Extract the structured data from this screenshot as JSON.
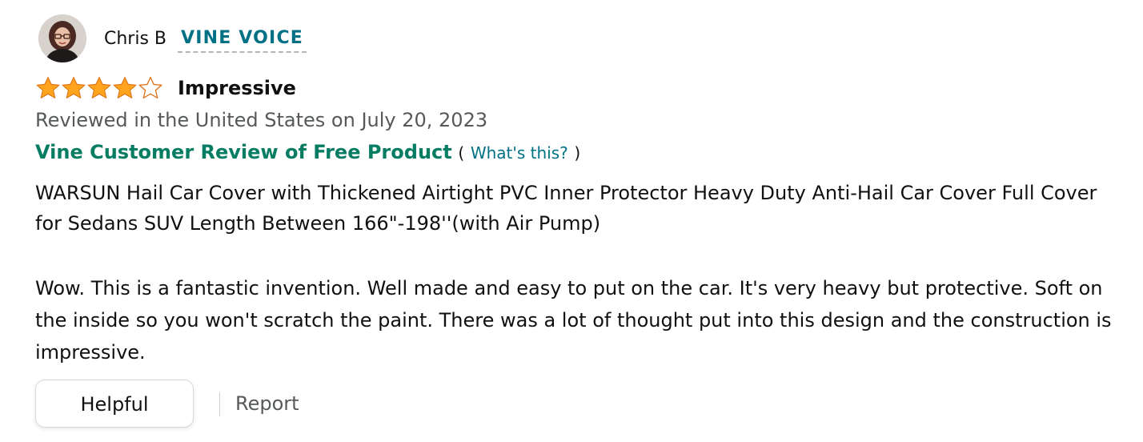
{
  "review": {
    "author": {
      "name": "Chris B",
      "badge": "VINE VOICE",
      "avatar_icon": "user-avatar-photo"
    },
    "rating": {
      "value": 4,
      "max": 5,
      "filled_star_color": "#ffa41c",
      "star_outline_color": "#de7921"
    },
    "title": "Impressive",
    "date_line": "Reviewed in the United States on July 20, 2023",
    "vine": {
      "label": "Vine Customer Review of Free Product",
      "paren_open": "(",
      "link": "What's this?",
      "paren_close": ")"
    },
    "product_title": "WARSUN Hail Car Cover with Thickened Airtight PVC Inner Protector Heavy Duty Anti-Hail Car Cover Full Cover for Sedans SUV Length Between 166\"-198''(with Air Pump)",
    "body": "Wow. This is a fantastic invention. Well made and easy to put on the car. It's very heavy but protective. Soft on the inside so you won't scratch the paint. There was a lot of thought put into this design and the construction is impressive.",
    "actions": {
      "helpful_label": "Helpful",
      "report_label": "Report"
    }
  },
  "colors": {
    "link": "#007185",
    "vine_green": "#067d62",
    "secondary_text": "#565959"
  }
}
